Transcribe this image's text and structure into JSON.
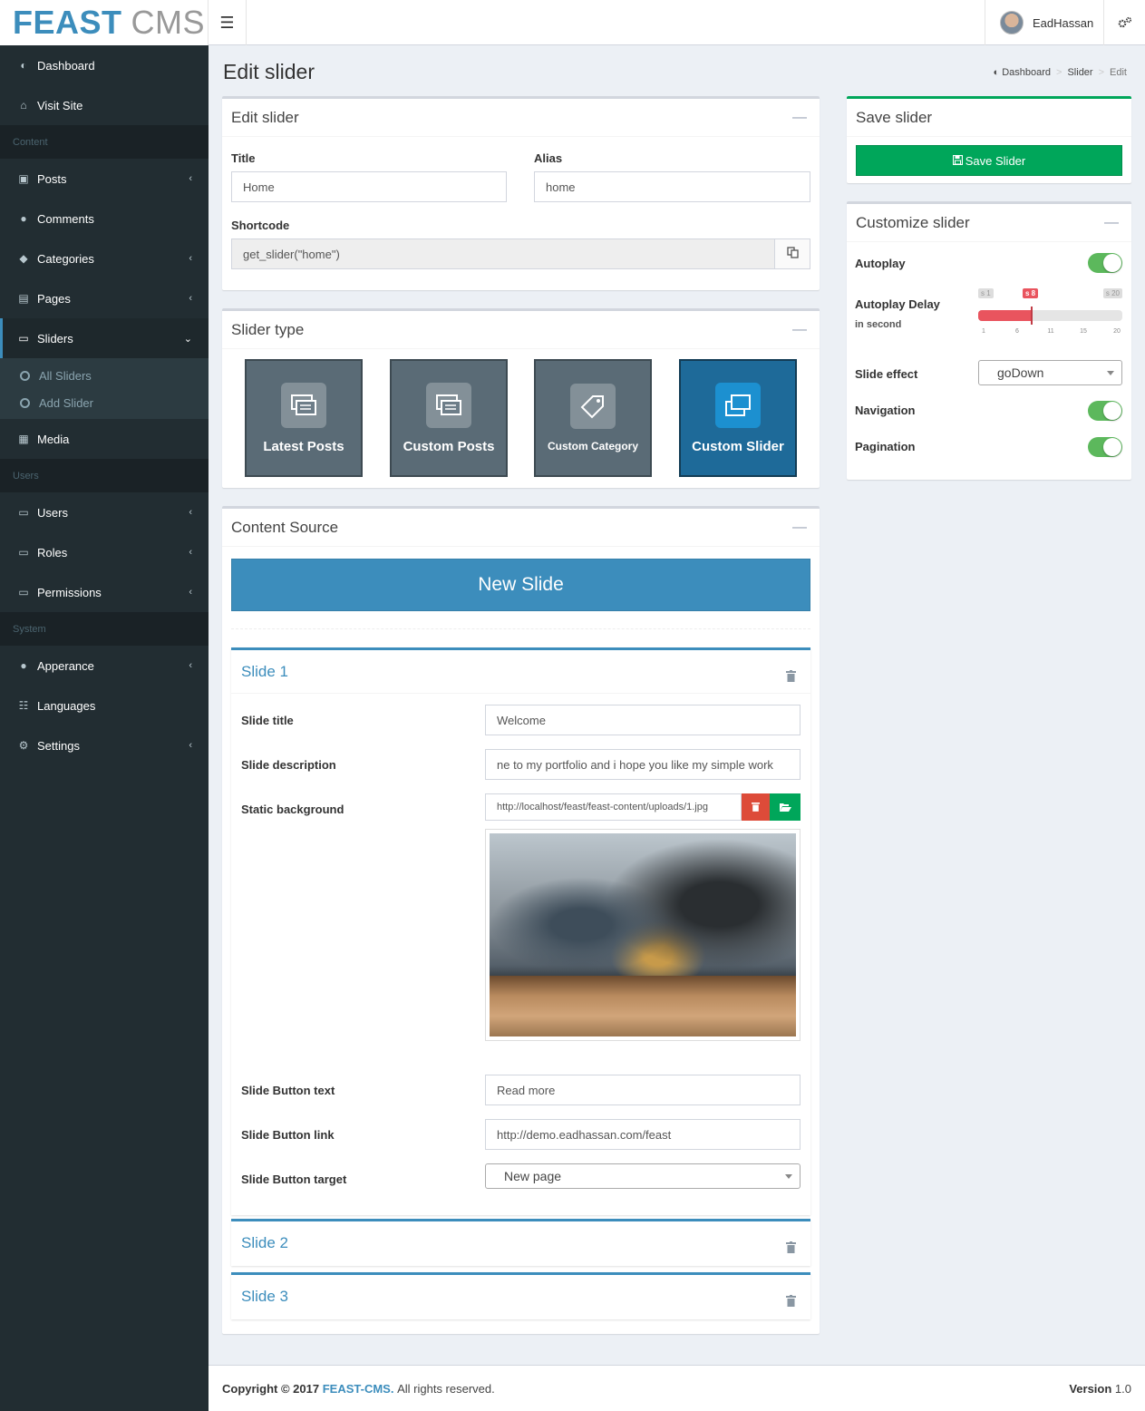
{
  "logo": {
    "bold": "FEAST",
    "light": "CMS"
  },
  "header": {
    "user_name": "EadHassan"
  },
  "sidebar": {
    "top_items": [
      {
        "label": "Dashboard"
      },
      {
        "label": "Visit Site"
      }
    ],
    "section_content": "Content",
    "content_items": [
      {
        "label": "Posts"
      },
      {
        "label": "Comments"
      },
      {
        "label": "Categories"
      },
      {
        "label": "Pages"
      },
      {
        "label": "Sliders"
      },
      {
        "label": "Media"
      }
    ],
    "sliders_sub": [
      {
        "label": "All Sliders"
      },
      {
        "label": "Add Slider"
      }
    ],
    "section_users": "Users",
    "users_items": [
      {
        "label": "Users"
      },
      {
        "label": "Roles"
      },
      {
        "label": "Permissions"
      }
    ],
    "section_system": "System",
    "system_items": [
      {
        "label": "Apperance"
      },
      {
        "label": "Languages"
      },
      {
        "label": "Settings"
      }
    ]
  },
  "page": {
    "title": "Edit slider"
  },
  "breadcrumb": {
    "home": "Dashboard",
    "section": "Slider",
    "current": "Edit",
    "sep": ">"
  },
  "edit_box": {
    "title": "Edit slider",
    "title_label": "Title",
    "title_value": "Home",
    "alias_label": "Alias",
    "alias_value": "home",
    "shortcode_label": "Shortcode",
    "shortcode_value": "get_slider(\"home\")"
  },
  "type_box": {
    "title": "Slider type",
    "types": [
      {
        "label": "Latest Posts"
      },
      {
        "label": "Custom Posts"
      },
      {
        "label": "Custom Category"
      },
      {
        "label": "Custom Slider"
      }
    ]
  },
  "content_box": {
    "title": "Content Source",
    "new_slide": "New Slide",
    "slide1": {
      "heading": "Slide 1",
      "title_label": "Slide title",
      "title_value": "Welcome",
      "desc_label": "Slide description",
      "desc_value": "ne to my portfolio and i hope you like my simple work",
      "bg_label": "Static background",
      "bg_value": "http://localhost/feast/feast-content/uploads/1.jpg",
      "btn_text_label": "Slide Button text",
      "btn_text_value": "Read more",
      "btn_link_label": "Slide Button link",
      "btn_link_value": "http://demo.eadhassan.com/feast",
      "btn_target_label": "Slide Button target",
      "btn_target_value": "New page"
    },
    "slide2": {
      "heading": "Slide 2"
    },
    "slide3": {
      "heading": "Slide 3"
    }
  },
  "save_box": {
    "title": "Save slider",
    "button": "Save Slider"
  },
  "customize_box": {
    "title": "Customize slider",
    "autoplay_label": "Autoplay",
    "delay_label": "Autoplay Delay",
    "delay_sub": "in second",
    "delay_min_label": "s 1",
    "delay_value_label": "s 8",
    "delay_max_label": "s 20",
    "delay_min": 1,
    "delay_max": 20,
    "delay_value": 8,
    "delay_ticks": [
      "1",
      "6",
      "11",
      "15",
      "20"
    ],
    "effect_label": "Slide effect",
    "effect_value": "goDown",
    "navigation_label": "Navigation",
    "pagination_label": "Pagination"
  },
  "footer": {
    "copyright": "Copyright © 2017",
    "brand": "FEAST-CMS.",
    "rights": "All rights reserved.",
    "version_label": "Version",
    "version": "1.0"
  },
  "colors": {
    "primary": "#3c8dbc",
    "success": "#00a65a",
    "danger": "#dd4b39",
    "sidebar": "#222d32",
    "slider_fill": "#e9545e"
  }
}
